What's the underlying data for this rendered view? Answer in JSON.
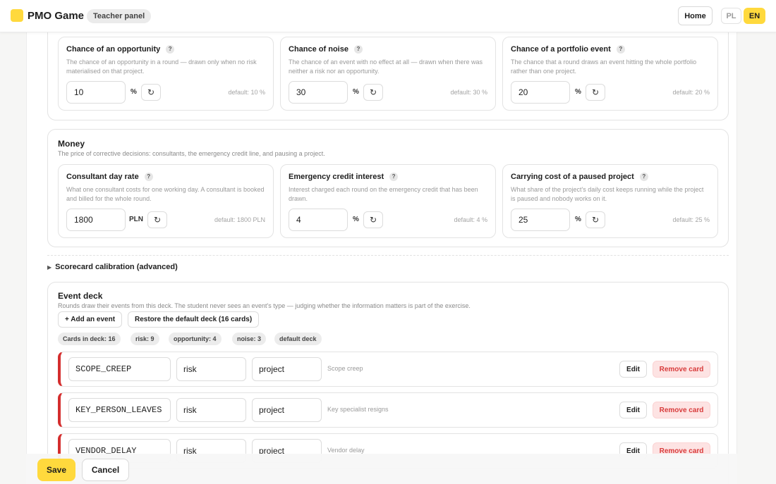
{
  "header": {
    "app_title": "PMO Game",
    "role_badge": "Teacher panel",
    "home_label": "Home",
    "lang_pl": "PL",
    "lang_en": "EN",
    "active_lang": "EN",
    "accent_color": "#ffd93d"
  },
  "probabilities": {
    "opportunity": {
      "title": "Chance of an opportunity",
      "help": "?",
      "desc": "The chance of an opportunity in a round — drawn only when no risk materialised on that project.",
      "value": "10",
      "unit": "%",
      "default": "default: 10 %"
    },
    "noise": {
      "title": "Chance of noise",
      "help": "?",
      "desc": "The chance of an event with no effect at all — drawn when there was neither a risk nor an opportunity.",
      "value": "30",
      "unit": "%",
      "default": "default: 30 %"
    },
    "portfolio": {
      "title": "Chance of a portfolio event",
      "help": "?",
      "desc": "The chance that a round draws an event hitting the whole portfolio rather than one project.",
      "value": "20",
      "unit": "%",
      "default": "default: 20 %"
    }
  },
  "money": {
    "title": "Money",
    "desc": "The price of corrective decisions: consultants, the emergency credit line, and pausing a project.",
    "consultant": {
      "title": "Consultant day rate",
      "help": "?",
      "desc": "What one consultant costs for one working day. A consultant is booked and billed for the whole round.",
      "value": "1800",
      "unit": "PLN",
      "default": "default: 1800 PLN"
    },
    "credit": {
      "title": "Emergency credit interest",
      "help": "?",
      "desc": "Interest charged each round on the emergency credit that has been drawn.",
      "value": "4",
      "unit": "%",
      "default": "default: 4 %"
    },
    "paused": {
      "title": "Carrying cost of a paused project",
      "help": "?",
      "desc": "What share of the project's daily cost keeps running while the project is paused and nobody works on it.",
      "value": "25",
      "unit": "%",
      "default": "default: 25 %"
    }
  },
  "advanced": {
    "label": "Scorecard calibration (advanced)"
  },
  "deck": {
    "title": "Event deck",
    "desc": "Rounds draw their events from this deck. The student never sees an event's type — judging whether the information matters is part of the exercise.",
    "add_label": "+ Add an event",
    "restore_label": "Restore the default deck (16 cards)",
    "chips": {
      "cards": "Cards in deck:  16",
      "risk": "risk:  9",
      "opportunity": "opportunity:  4",
      "noise": "noise:  3",
      "default": "default deck"
    },
    "events": [
      {
        "code": "SCOPE_CREEP",
        "type": "risk",
        "scope": "project",
        "name": "Scope creep"
      },
      {
        "code": "KEY_PERSON_LEAVES",
        "type": "risk",
        "scope": "project",
        "name": "Key specialist resigns"
      },
      {
        "code": "VENDOR_DELAY",
        "type": "risk",
        "scope": "project",
        "name": "Vendor delay"
      }
    ],
    "edit_label": "Edit",
    "remove_label": "Remove card",
    "risk_color": "#d42e2e"
  },
  "actions": {
    "save_label": "Save",
    "cancel_label": "Cancel"
  }
}
